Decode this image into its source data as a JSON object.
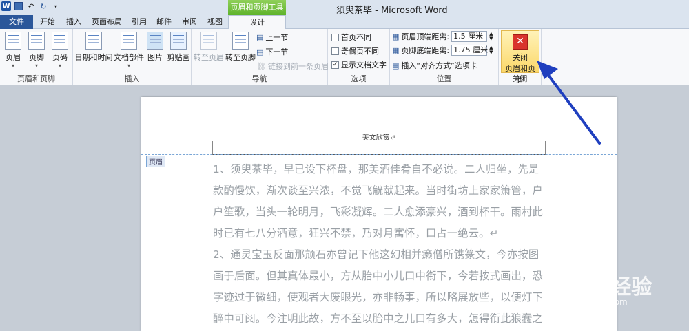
{
  "window": {
    "title": "须臾茶毕 - Microsoft Word"
  },
  "context_tab": {
    "header": "页眉和页脚工具"
  },
  "tabs": {
    "file": "文件",
    "home": "开始",
    "insert": "插入",
    "layout": "页面布局",
    "references": "引用",
    "mailings": "邮件",
    "review": "审阅",
    "view": "视图",
    "design": "设计"
  },
  "ribbon": {
    "hf": {
      "header": "页眉",
      "footer": "页脚",
      "page_number": "页码",
      "label": "页眉和页脚"
    },
    "insert": {
      "datetime": "日期和时间",
      "quick_parts": "文档部件",
      "picture": "图片",
      "clipart": "剪贴画",
      "label": "插入"
    },
    "nav": {
      "goto_header": "转至页眉",
      "goto_footer": "转至页脚",
      "prev": "上一节",
      "next": "下一节",
      "link_prev": "链接到前一条页眉",
      "label": "导航"
    },
    "options": {
      "diff_first": "首页不同",
      "diff_odd_even": "奇偶页不同",
      "show_text": "显示文档文字",
      "label": "选项"
    },
    "position": {
      "header_top_label": "页眉顶端距离:",
      "header_top_value": "1.5 厘米",
      "footer_bottom_label": "页脚底端距离:",
      "footer_bottom_value": "1.75 厘米",
      "insert_align_tab": "插入“对齐方式”选项卡",
      "label": "位置"
    },
    "close": {
      "line1": "关闭",
      "line2": "页眉和页脚",
      "label": "关闭"
    }
  },
  "document": {
    "header_text": "美文欣赏↵",
    "header_tag": "页眉",
    "lines": [
      "1、须臾茶毕，早已设下杯盘，那美酒佳肴自不必说。二人归坐，先是",
      "款酌慢饮，渐次谈至兴浓，不觉飞觥献起来。当时街坊上家家箫管，户",
      "户笙歌，当头一轮明月，飞彩凝辉。二人愈添豪兴，酒到杯干。雨村此",
      "时已有七八分酒意，狂兴不禁，乃对月寓怀，口占一绝云。↵",
      "2、通灵宝玉反面那颃石亦曾记下他这幻相并癞僧所镌篆文，今亦按图",
      "画于后面。但其真体最小，方从胎中小儿口中衔下，今若按式画出，恐",
      "字迹过于微细，使观者大废眼光，亦非畅事，所以略展放些，以便灯下",
      "醉中可阅。今注明此故，方不至以胎中之儿口有多大，怎得衔此狼蠢之"
    ]
  },
  "watermark": {
    "brand": "Baidu经验",
    "url": "jingyan.baidu.com"
  },
  "colors": {
    "file_tab": "#2b579a",
    "context_green": "#6cbb35",
    "arrow": "#1f3fbf",
    "close_red": "#d9342c"
  }
}
